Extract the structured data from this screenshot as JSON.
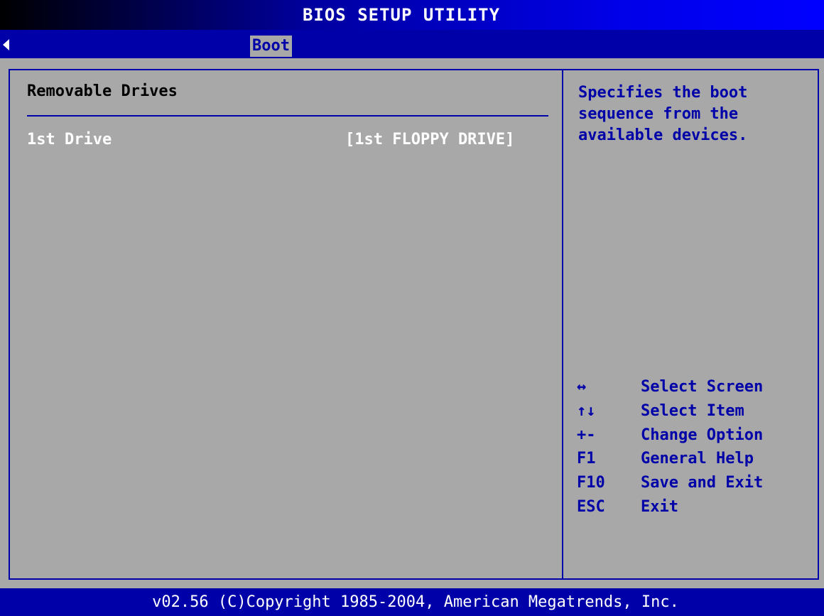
{
  "title": "BIOS SETUP UTILITY",
  "menu": {
    "active_tab": "Boot"
  },
  "section": {
    "title": "Removable Drives",
    "items": [
      {
        "label": "1st Drive",
        "value": "[1st FLOPPY DRIVE]"
      }
    ]
  },
  "help": {
    "lines": [
      "Specifies the boot",
      "sequence from the",
      "available devices."
    ]
  },
  "keys": [
    {
      "key": "↔",
      "desc": "Select Screen"
    },
    {
      "key": "↑↓",
      "desc": "Select Item"
    },
    {
      "key": "+-",
      "desc": "Change Option"
    },
    {
      "key": "F1",
      "desc": "General Help"
    },
    {
      "key": "F10",
      "desc": "Save and Exit"
    },
    {
      "key": "ESC",
      "desc": "Exit"
    }
  ],
  "footer": "v02.56 (C)Copyright 1985-2004, American Megatrends, Inc.",
  "colors": {
    "background": "#a8a8a8",
    "accent": "#0000a8",
    "text_highlight": "#ffffff"
  }
}
